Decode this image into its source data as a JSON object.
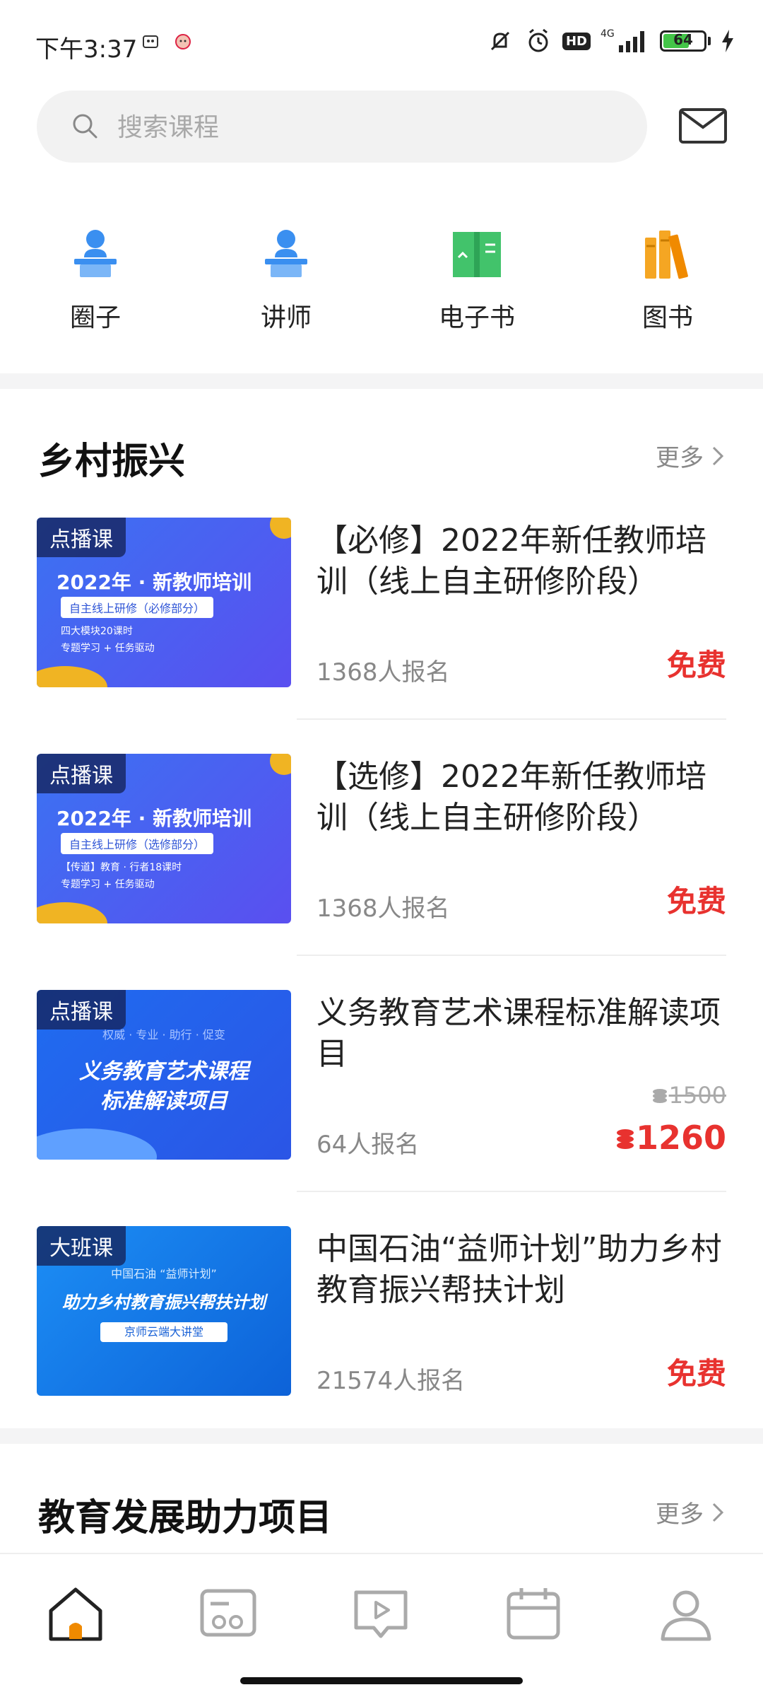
{
  "status_bar": {
    "time": "下午3:37",
    "network": "4G",
    "hd": "HD",
    "battery_level": "64",
    "battery_fraction": 0.64,
    "icons": [
      "notification-app-icon",
      "notification-app-icon-2",
      "mute-icon",
      "alarm-icon",
      "hd-icon",
      "signal-icon",
      "battery-icon",
      "charging-icon"
    ]
  },
  "search": {
    "placeholder": "搜索课程"
  },
  "header": {
    "icons": [
      "search-icon",
      "mail-icon"
    ]
  },
  "quick_nav": [
    {
      "label": "圈子",
      "icon": "person-podium-icon",
      "color": "#3a8ff0"
    },
    {
      "label": "讲师",
      "icon": "lecturer-icon",
      "color": "#3a8ff0"
    },
    {
      "label": "电子书",
      "icon": "ebook-icon",
      "color": "#42c36b"
    },
    {
      "label": "图书",
      "icon": "books-icon",
      "color": "#f5a623"
    }
  ],
  "section1": {
    "title": "乡村振兴",
    "more": "更多",
    "courses": [
      {
        "badge": "点播课",
        "title": "【必修】2022年新任教师培训（线上自主研修阶段）",
        "enroll": "1368人报名",
        "price": "免费",
        "thumb": {
          "line1": "2022年 · 新教师培训",
          "line2": "自主线上研修（必修部分）",
          "line3": "四大模块20课时",
          "line4": "专题学习 + 任务驱动"
        }
      },
      {
        "badge": "点播课",
        "title": "【选修】2022年新任教师培训（线上自主研修阶段）",
        "enroll": "1368人报名",
        "price": "免费",
        "thumb": {
          "line1": "2022年 · 新教师培训",
          "line2": "自主线上研修（选修部分）",
          "line3": "【传道】教育 · 行者18课时",
          "line4": "专题学习 + 任务驱动"
        }
      },
      {
        "badge": "点播课",
        "title": "义务教育艺术课程标准解读项目",
        "enroll": "64人报名",
        "price_old": "1500",
        "price_now": "1260",
        "thumb": {
          "line1": "权威 · 专业 · 助行 · 促变",
          "line2": "义务教育艺术课程",
          "line3": "标准解读项目"
        }
      },
      {
        "badge": "大班课",
        "title": "中国石油“益师计划”助力乡村教育振兴帮扶计划",
        "enroll": "21574人报名",
        "price": "免费",
        "thumb": {
          "line1": "中国石油 “益师计划”",
          "line2": "助力乡村教育振兴帮扶计划",
          "line3": "京师云端大讲堂"
        }
      }
    ]
  },
  "section2": {
    "title": "教育发展助力项目",
    "more": "更多"
  },
  "bottom_nav": [
    {
      "name": "home",
      "icon": "home-icon",
      "active": true
    },
    {
      "name": "community",
      "icon": "community-icon",
      "active": false
    },
    {
      "name": "video",
      "icon": "video-play-icon",
      "active": false
    },
    {
      "name": "calendar",
      "icon": "calendar-icon",
      "active": false
    },
    {
      "name": "profile",
      "icon": "profile-icon",
      "active": false
    }
  ],
  "colors": {
    "accent_red": "#e8322f",
    "accent_orange": "#f08a00",
    "thumb_blue": "#2f6ff0"
  }
}
